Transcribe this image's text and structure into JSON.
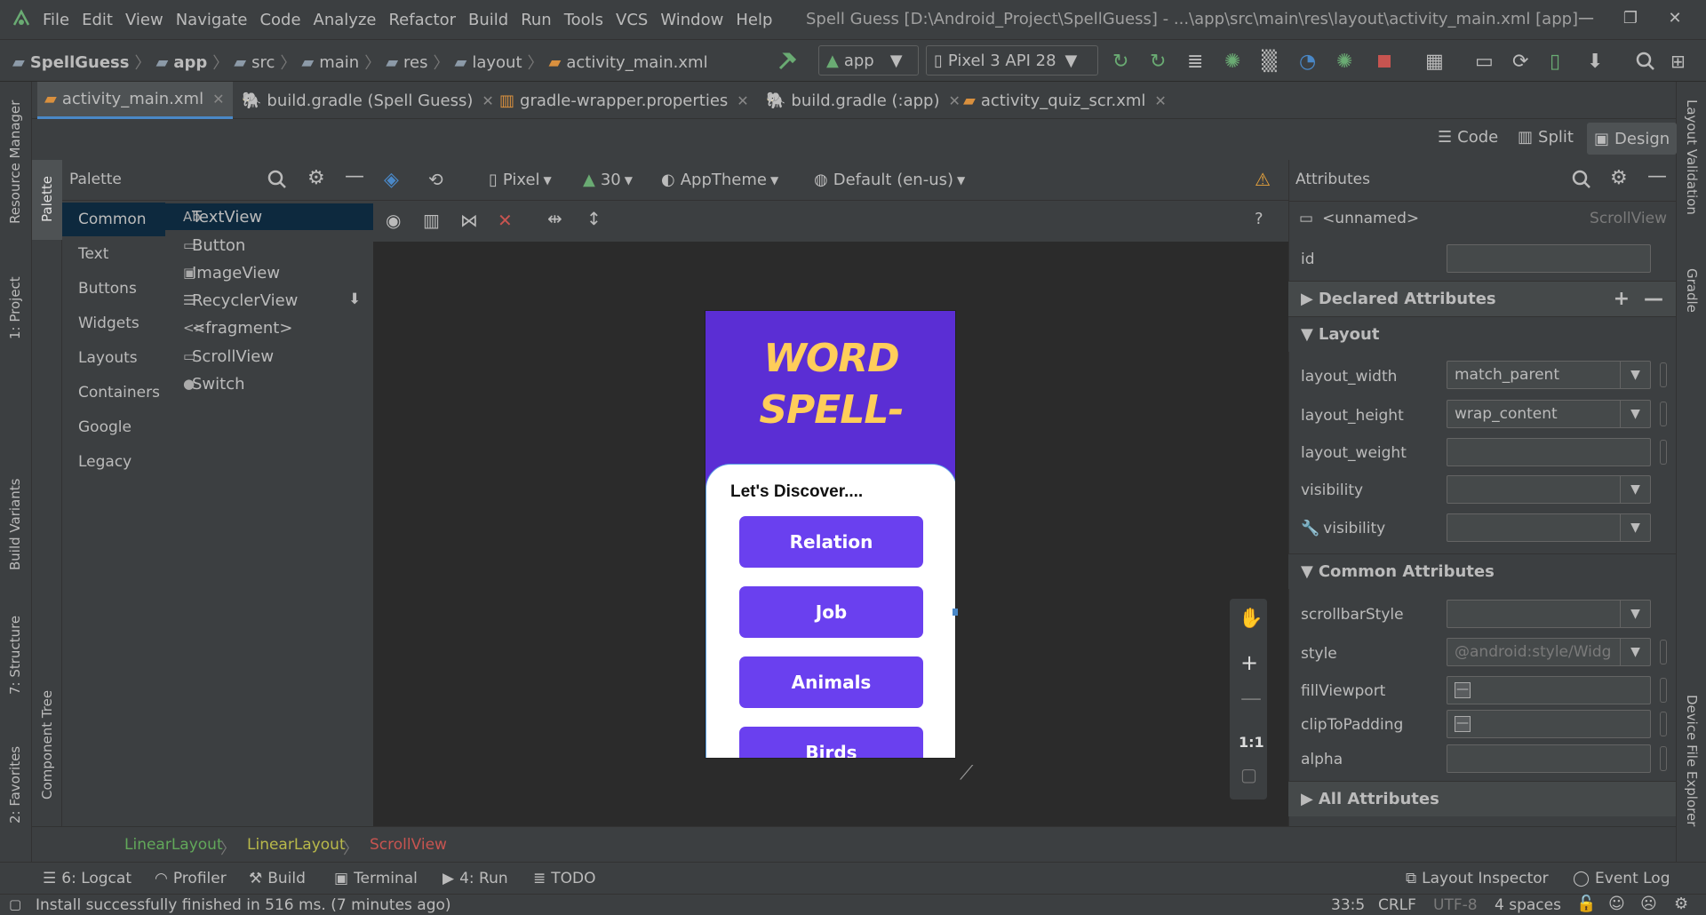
{
  "menu": {
    "items": [
      "File",
      "Edit",
      "View",
      "Navigate",
      "Code",
      "Analyze",
      "Refactor",
      "Build",
      "Run",
      "Tools",
      "VCS",
      "Window",
      "Help"
    ],
    "title": "Spell Guess [D:\\Android_Project\\SpellGuess] - ...\\app\\src\\main\\res\\layout\\activity_main.xml [app]"
  },
  "navbar": {
    "crumbs": [
      "SpellGuess",
      "app",
      "src",
      "main",
      "res",
      "layout",
      "activity_main.xml"
    ],
    "run_config": "app",
    "device": "Pixel 3 API 28"
  },
  "tabs": [
    {
      "label": "activity_main.xml",
      "active": true
    },
    {
      "label": "build.gradle (Spell Guess)"
    },
    {
      "label": "gradle-wrapper.properties"
    },
    {
      "label": "build.gradle (:app)"
    },
    {
      "label": "activity_quiz_scr.xml"
    }
  ],
  "view_modes": {
    "code": "Code",
    "split": "Split",
    "design": "Design"
  },
  "palette": {
    "title": "Palette",
    "categories": [
      "Common",
      "Text",
      "Buttons",
      "Widgets",
      "Layouts",
      "Containers",
      "Google",
      "Legacy"
    ],
    "items": [
      {
        "icon": "Ab",
        "label": "TextView"
      },
      {
        "icon": "▭",
        "label": "Button"
      },
      {
        "icon": "▣",
        "label": "ImageView"
      },
      {
        "icon": "☰",
        "label": "RecyclerView"
      },
      {
        "icon": "<>",
        "label": "<fragment>"
      },
      {
        "icon": "▭",
        "label": "ScrollView"
      },
      {
        "icon": "●",
        "label": "Switch"
      }
    ]
  },
  "design_toolbar": {
    "device": "Pixel",
    "api": "30",
    "theme": "AppTheme",
    "locale": "Default (en-us)"
  },
  "preview": {
    "title_line1": "WORD",
    "title_line2": "SPELL-",
    "heading": "Let's Discover....",
    "buttons": [
      "Relation",
      "Job",
      "Animals",
      "Birds"
    ]
  },
  "zoom": {
    "fit": "1:1"
  },
  "attributes": {
    "title": "Attributes",
    "component": "<unnamed>",
    "component_type": "ScrollView",
    "id_label": "id",
    "declared": "Declared Attributes",
    "layout_section": "Layout",
    "layout_rows": [
      {
        "label": "layout_width",
        "value": "match_parent"
      },
      {
        "label": "layout_height",
        "value": "wrap_content"
      },
      {
        "label": "layout_weight",
        "value": ""
      },
      {
        "label": "visibility",
        "value": ""
      },
      {
        "label": "visibility",
        "value": ""
      }
    ],
    "common_section": "Common Attributes",
    "common_rows": [
      {
        "label": "scrollbarStyle",
        "value": ""
      },
      {
        "label": "style",
        "value": "@android:style/Widg"
      },
      {
        "label": "fillViewport",
        "value": ""
      },
      {
        "label": "clipToPadding",
        "value": ""
      },
      {
        "label": "alpha",
        "value": ""
      }
    ],
    "all": "All Attributes"
  },
  "left_stripe": [
    "Resource Manager",
    "1: Project",
    "Build Variants",
    "7: Structure",
    "2: Favorites"
  ],
  "palette_stripe": [
    "Palette",
    "Component Tree"
  ],
  "right_stripe": [
    "Layout Validation",
    "Gradle",
    "Device File Explorer"
  ],
  "breadcrumb": [
    "LinearLayout",
    "LinearLayout",
    "ScrollView"
  ],
  "toolwindows": {
    "left": [
      "6: Logcat",
      "Profiler",
      "Build",
      "Terminal",
      "4: Run",
      "TODO"
    ],
    "right": [
      "Layout Inspector",
      "Event Log"
    ]
  },
  "status": {
    "message": "Install successfully finished in 516 ms. (7 minutes ago)",
    "position": "33:5",
    "line_sep": "CRLF",
    "encoding": "UTF-8",
    "indent": "4 spaces"
  },
  "colors": {
    "accent": "#4a88c7",
    "phone_header": "#5b2ed4",
    "phone_button": "#6a40ef",
    "title_yellow": "#ffcd5a",
    "crumb_green": "#62a85a",
    "crumb_yellow": "#b9b94a",
    "crumb_red": "#c75450"
  }
}
